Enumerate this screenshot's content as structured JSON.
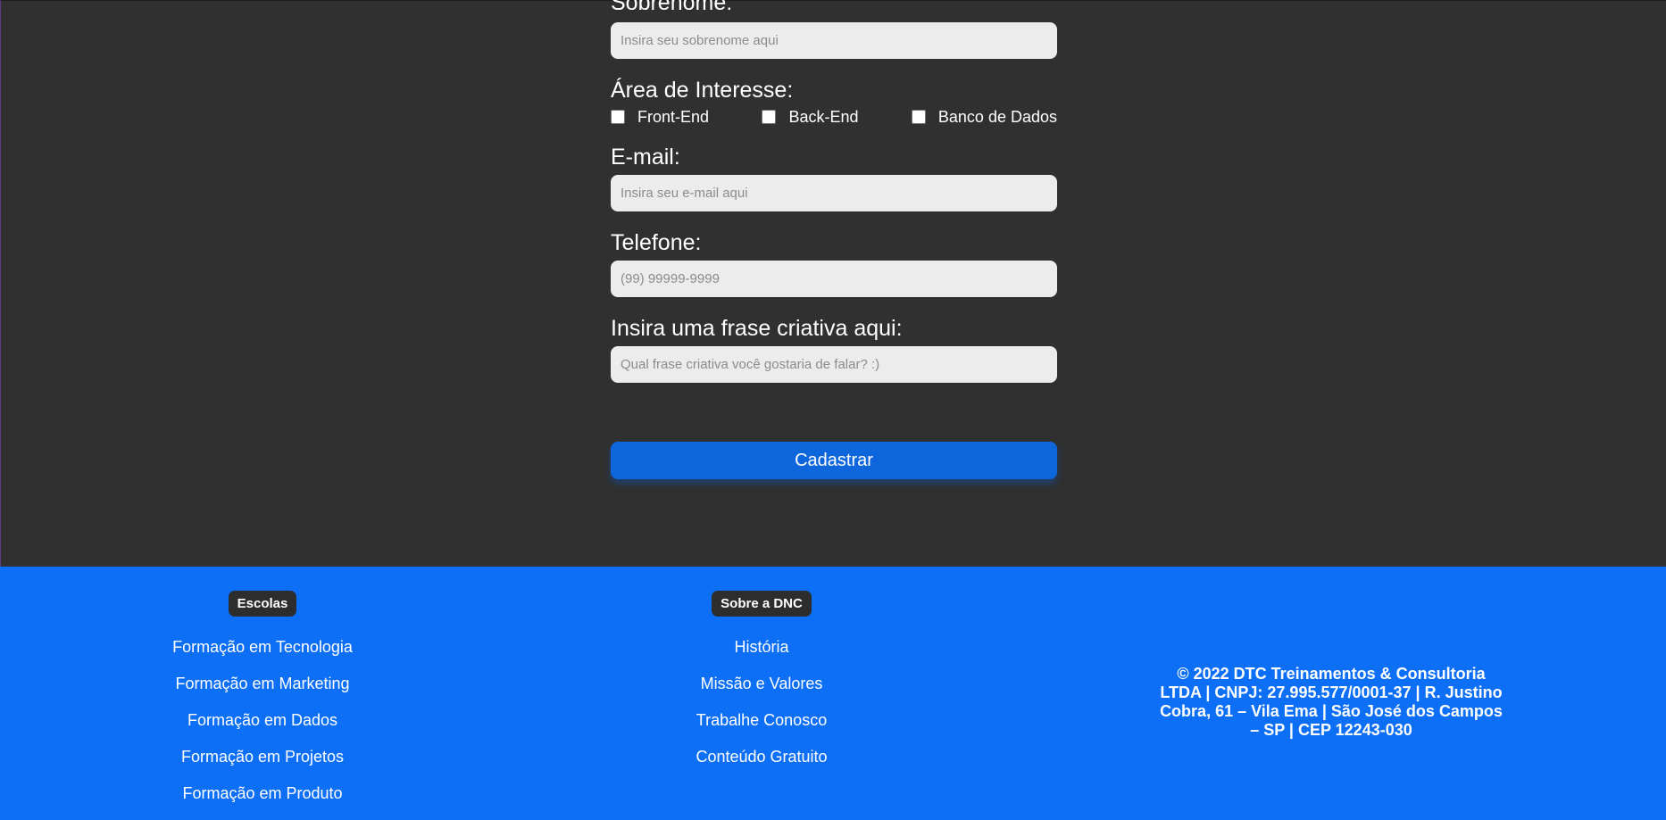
{
  "form": {
    "sobrenome": {
      "label": "Sobrenome:",
      "placeholder": "Insira seu sobrenome aqui"
    },
    "area_interesse": {
      "label": "Área de Interesse:",
      "options": [
        "Front-End",
        "Back-End",
        "Banco de Dados"
      ]
    },
    "email": {
      "label": "E-mail:",
      "placeholder": "Insira seu e-mail aqui"
    },
    "telefone": {
      "label": "Telefone:",
      "placeholder": "(99) 99999-9999"
    },
    "frase": {
      "label": "Insira uma frase criativa aqui:",
      "placeholder": "Qual frase criativa você gostaria de falar? :)"
    },
    "submit_label": "Cadastrar"
  },
  "footer": {
    "escolas": {
      "title": "Escolas",
      "links": [
        "Formação em Tecnologia",
        "Formação em Marketing",
        "Formação em Dados",
        "Formação em Projetos",
        "Formação em Produto"
      ]
    },
    "sobre": {
      "title": "Sobre a DNC",
      "links": [
        "História",
        "Missão e Valores",
        "Trabalhe Conosco",
        "Conteúdo Gratuito"
      ]
    },
    "copyright": "© 2022 DTC Treinamentos & Consultoria LTDA | CNPJ: 27.995.577/0001-37 | R. Justino Cobra, 61 – Vila Ema | São José dos Campos – SP | CEP 12243-030"
  },
  "colors": {
    "background": "#303030",
    "footer": "#0c6ff5",
    "button": "#0e66dc",
    "badge": "#2d2d2d"
  }
}
